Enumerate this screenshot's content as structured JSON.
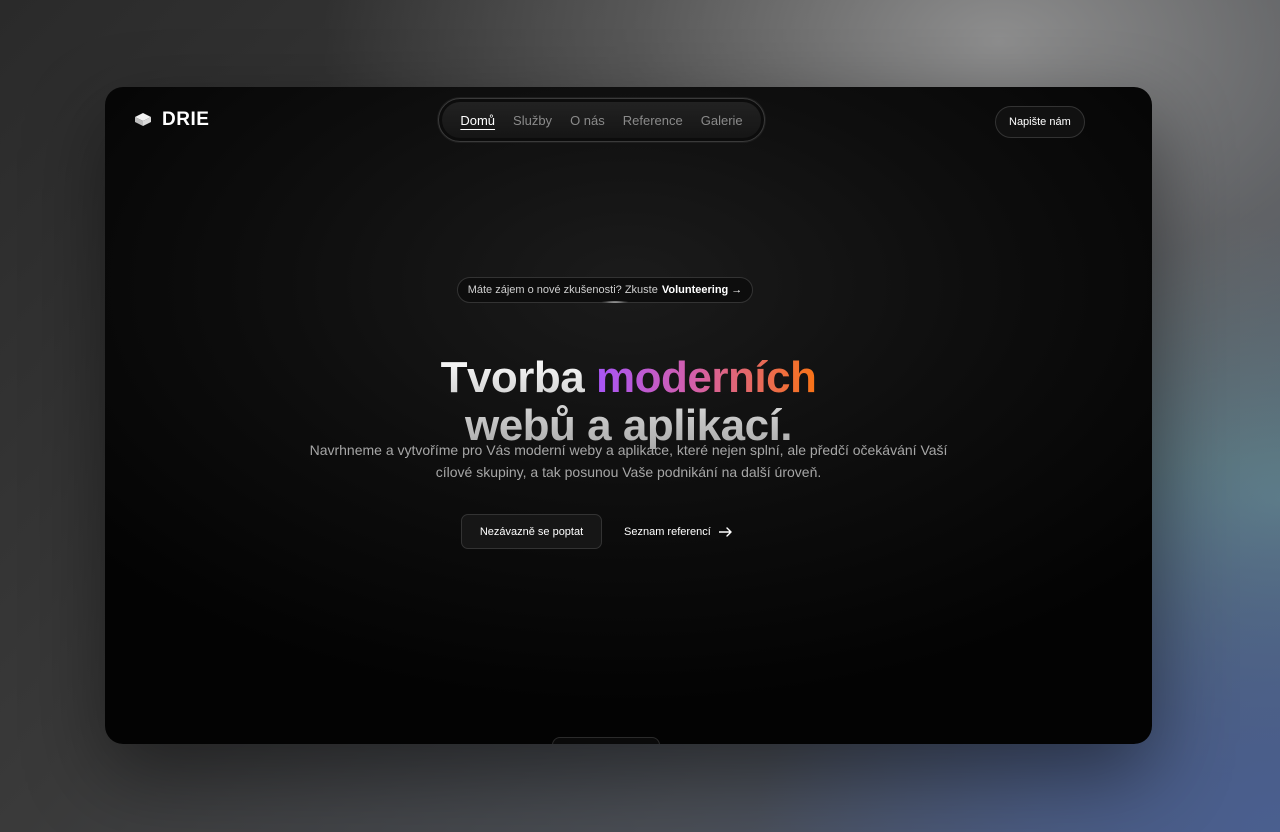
{
  "brand": {
    "name": "DRIE",
    "icon": "layers-icon"
  },
  "nav": {
    "items": [
      {
        "label": "Domů",
        "active": true
      },
      {
        "label": "Služby",
        "active": false
      },
      {
        "label": "O nás",
        "active": false
      },
      {
        "label": "Reference",
        "active": false
      },
      {
        "label": "Galerie",
        "active": false
      }
    ]
  },
  "header_cta": {
    "label": "Napište nám"
  },
  "announcement": {
    "text": "Máte zájem o nové zkušenosti? Zkuste",
    "link": "Volunteering →"
  },
  "hero": {
    "title_part1": "Tvorba ",
    "title_highlight": "moderních",
    "title_line2": "webů a aplikací.",
    "subtitle": "Navrhneme a vytvoříme pro Vás moderní weby a aplikace, které nejen splní, ale předčí očekávání Vaší cílové skupiny, a tak posunou Vaše podnikání na další úroveň.",
    "primary_button": "Nezávazně se poptat",
    "secondary_link": "Seznam referencí",
    "secondary_icon": "arrow-right-icon"
  },
  "colors": {
    "accent_gradient": [
      "#a855f7",
      "#d45fa8",
      "#f97316"
    ],
    "background": "#000000"
  }
}
